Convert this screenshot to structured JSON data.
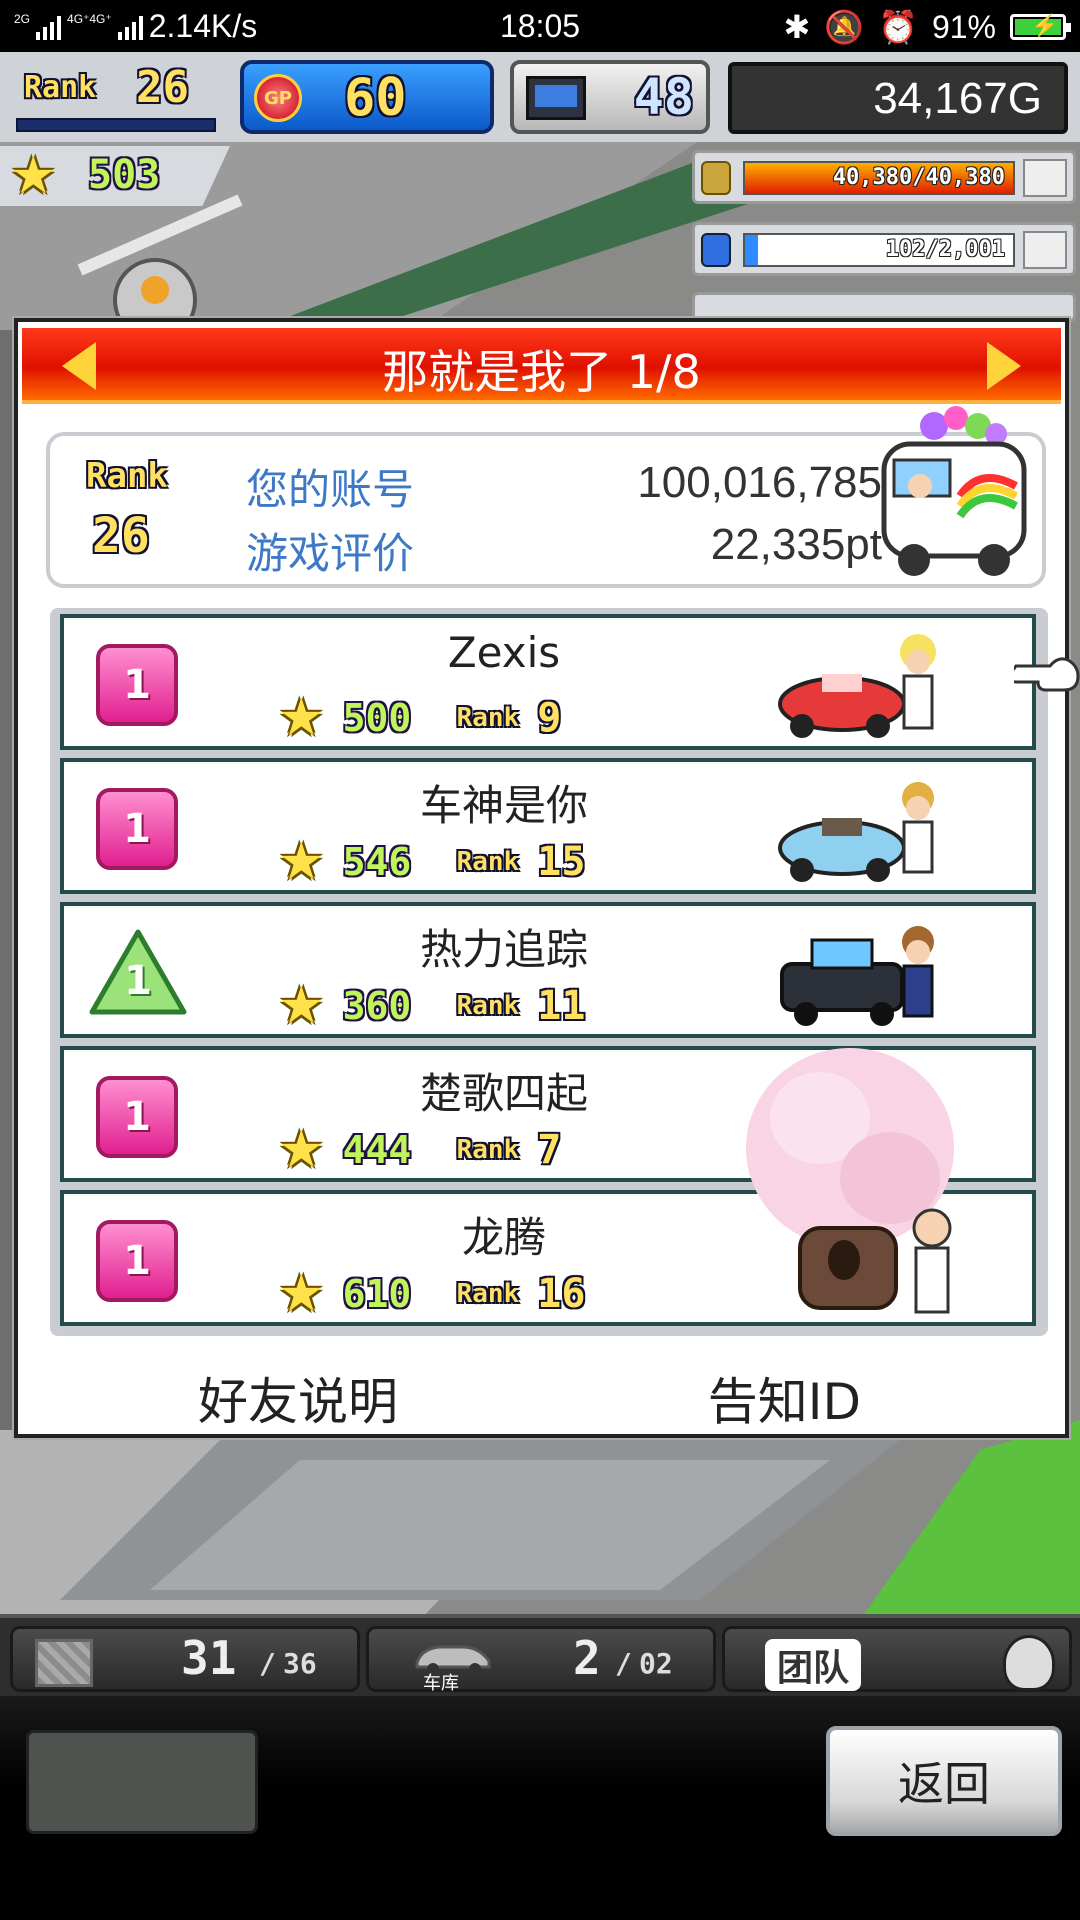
{
  "status_bar": {
    "sim1": "2G",
    "sim2": "4G⁺4G⁺",
    "speed": "2.14K/s",
    "time": "18:05",
    "battery": "91%"
  },
  "hud": {
    "rank_label": "Rank",
    "rank_value": "26",
    "gp_label": "GP",
    "gp_value": "60",
    "pc_value": "48",
    "gold": "34,167G",
    "stars": "503",
    "res1": "40,380/40,380",
    "res1_fill": 1.0,
    "res2": "102/2,001",
    "res2_fill": 0.05
  },
  "dialog": {
    "title": "那就是我了 1/8",
    "account": {
      "rank_label": "Rank",
      "rank_value": "26",
      "id_label": "您的账号",
      "id_value": "100,016,785",
      "rating_label": "游戏评价",
      "rating_value": "22,335pt"
    },
    "rank_label": "Rank",
    "friends": [
      {
        "badge": "1",
        "badge_shape": "square",
        "name": "Zexis",
        "points": "500",
        "rank": "9"
      },
      {
        "badge": "1",
        "badge_shape": "square",
        "name": "车神是你",
        "points": "546",
        "rank": "15"
      },
      {
        "badge": "1",
        "badge_shape": "triangle",
        "name": "热力追踪",
        "points": "360",
        "rank": "11"
      },
      {
        "badge": "1",
        "badge_shape": "square",
        "name": "楚歌四起",
        "points": "444",
        "rank": "7"
      },
      {
        "badge": "1",
        "badge_shape": "square",
        "name": "龙腾",
        "points": "610",
        "rank": "16"
      }
    ],
    "footer_left": "好友说明",
    "footer_right": "告知ID"
  },
  "bottom": {
    "storage_current": "31",
    "storage_max": "36",
    "garage_label": "车库",
    "garage_current": "2",
    "garage_max": "02",
    "team_label": "团队",
    "back_label": "返回"
  },
  "colors": {
    "header_red": "#e01000",
    "badge_pink": "#e0208f",
    "badge_green": "#7fd45a",
    "link_blue": "#3d79c6"
  }
}
